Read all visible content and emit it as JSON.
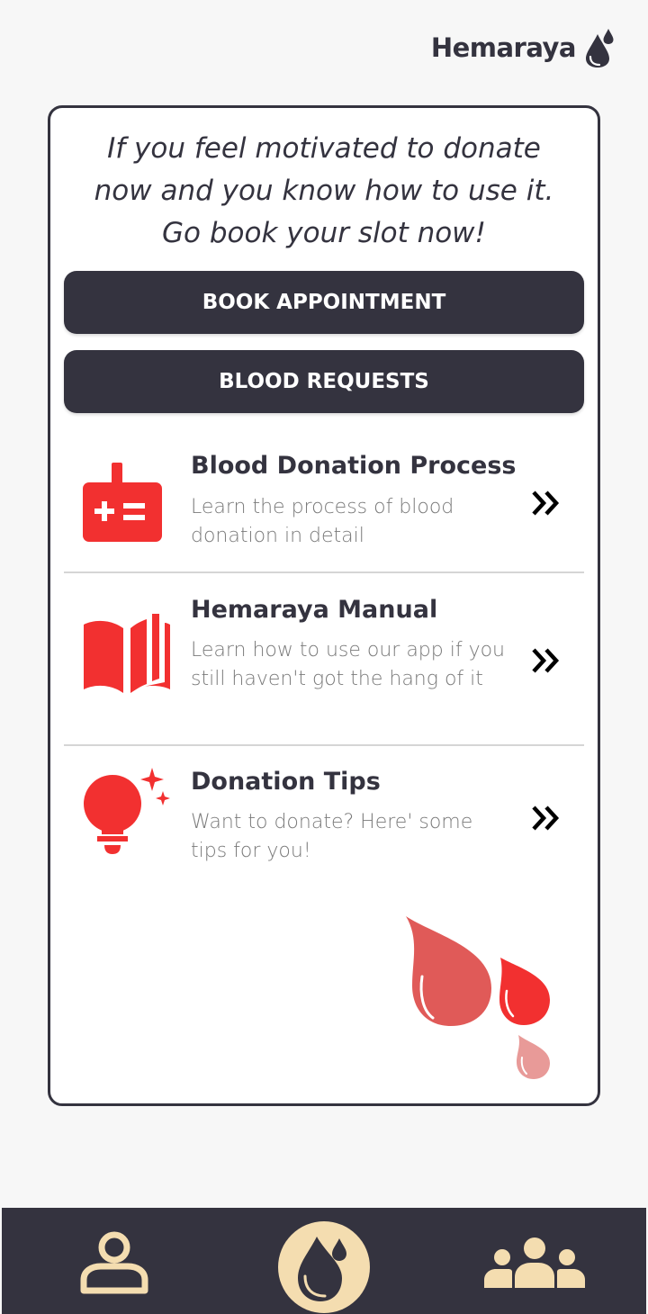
{
  "header": {
    "app_name": "Hemaraya",
    "logo_icon": "blood-drop-logo-icon"
  },
  "card": {
    "motivation_lines": [
      "If you feel motivated to donate",
      "now and you know how to use it.",
      "Go book your slot now!"
    ],
    "book_button_label": "BOOK APPOINTMENT",
    "requests_button_label": "BLOOD REQUESTS",
    "items": [
      {
        "title": "Blood Donation Process",
        "description": "Learn the process of blood donation in detail",
        "icon": "medical-kit-icon",
        "arrow_icon": "double-chevron-right-icon"
      },
      {
        "title": "Hemaraya Manual",
        "description": "Learn how to use our app if you still haven't got the hang of it",
        "icon": "open-book-icon",
        "arrow_icon": "double-chevron-right-icon"
      },
      {
        "title": "Donation Tips",
        "description": "Want to donate? Here' some tips for you!",
        "icon": "lightbulb-sparkle-icon",
        "arrow_icon": "double-chevron-right-icon"
      }
    ],
    "decoration_icon": "blood-drops-icon"
  },
  "bottom_nav": {
    "items": [
      {
        "icon": "profile-icon"
      },
      {
        "icon": "blood-drop-home-icon"
      },
      {
        "icon": "community-icon"
      }
    ]
  },
  "colors": {
    "background": "#f7f7f7",
    "dark": "#34333f",
    "accent_red": "#f23030",
    "nav_cream": "#f4ddb0",
    "muted_text": "#7a7a7a"
  }
}
